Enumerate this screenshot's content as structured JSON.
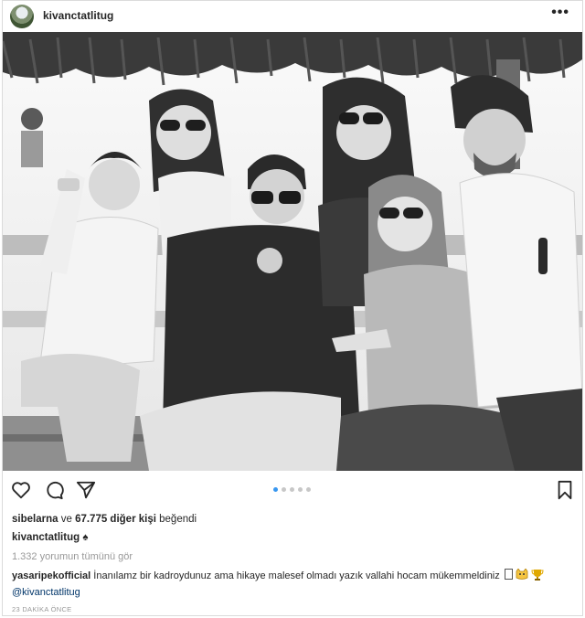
{
  "post": {
    "username": "kivanctatlitug",
    "more_icon": "more-horizontal-icon",
    "carousel": {
      "count": 5,
      "active": 1
    },
    "likes": {
      "first_user": "sibelarna",
      "connector": "ve",
      "others": "67.775 diğer kişi",
      "suffix": "beğendi"
    },
    "caption": {
      "username": "kivanctatlitug",
      "text": "♠"
    },
    "view_all_comments": "1.332 yorumun tümünü gör",
    "comment": {
      "username": "yasaripekofficial",
      "text": "İnanılamz bir kadroydunuz ama hikaye malesef olmadı yazık vallahi hocam mükemmeldiniz",
      "emoji_icons": [
        "box-glyph-icon",
        "cat-face-icon",
        "trophy-icon"
      ]
    },
    "mention": "@kivanctatlitug",
    "timestamp": "23 DAKİKA ÖNCE",
    "icons": [
      "heart-icon",
      "comment-icon",
      "share-icon",
      "bookmark-icon"
    ],
    "colors": {
      "link": "#003569",
      "active_dot": "#3897f0",
      "muted": "#999999"
    }
  }
}
